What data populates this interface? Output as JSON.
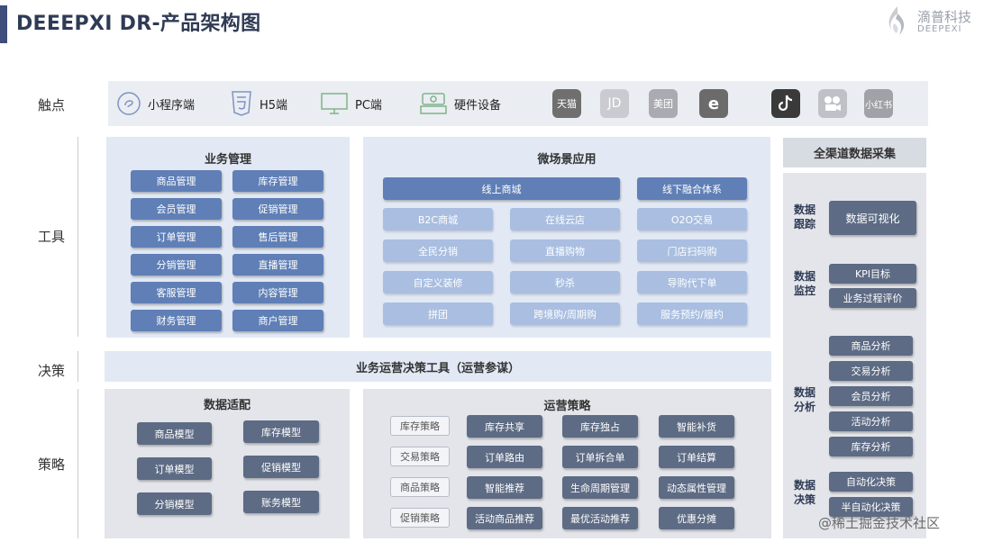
{
  "header": {
    "title": "DEEEPXI DR-产品架构图",
    "logo_cn": "滴普科技",
    "logo_en": "DEEPEXI"
  },
  "rows": {
    "touch": "触点",
    "tools": "工具",
    "decision": "决策",
    "strategy": "策略"
  },
  "touch": {
    "items": [
      "小程序端",
      "H5端",
      "PC端",
      "硬件设备"
    ],
    "apps": [
      "天猫",
      "JD",
      "美团",
      "e",
      "抖音",
      "",
      "小红书"
    ]
  },
  "business": {
    "title": "业务管理",
    "left": [
      "商品管理",
      "会员管理",
      "订单管理",
      "分销管理",
      "客服管理",
      "财务管理"
    ],
    "right": [
      "库存管理",
      "促销管理",
      "售后管理",
      "直播管理",
      "内容管理",
      "商户管理"
    ]
  },
  "micro": {
    "title": "微场景应用",
    "top": [
      "线上商城",
      "线下融合体系"
    ],
    "grid": [
      [
        "B2C商城",
        "在线云店",
        "O2O交易"
      ],
      [
        "全民分销",
        "直播购物",
        "门店扫码购"
      ],
      [
        "自定义装修",
        "秒杀",
        "导购代下单"
      ],
      [
        "拼团",
        "跨境购/周期购",
        "服务预约/履约"
      ]
    ]
  },
  "decision": {
    "label": "业务运营决策工具（运营参谋）"
  },
  "adapt": {
    "title": "数据适配",
    "left": [
      "商品模型",
      "订单模型",
      "分销模型"
    ],
    "right": [
      "库存模型",
      "促销模型",
      "账务模型"
    ]
  },
  "ops": {
    "title": "运营策略",
    "rows": [
      {
        "label": "库存策略",
        "items": [
          "库存共享",
          "库存独占",
          "智能补货"
        ]
      },
      {
        "label": "交易策略",
        "items": [
          "订单路由",
          "订单拆合单",
          "订单结算"
        ]
      },
      {
        "label": "商品策略",
        "items": [
          "智能推荐",
          "生命周期管理",
          "动态属性管理"
        ]
      },
      {
        "label": "促销策略",
        "items": [
          "活动商品推荐",
          "最优活动推荐",
          "优惠分摊"
        ]
      }
    ]
  },
  "collect": {
    "title": "全渠道数据采集",
    "tracking": {
      "label": [
        "数据",
        "跟踪"
      ],
      "items": [
        "数据可视化"
      ]
    },
    "monitor": {
      "label": [
        "数据",
        "监控"
      ],
      "items": [
        "KPI目标",
        "业务过程评价"
      ]
    },
    "analysis": {
      "label": [
        "数据",
        "分析"
      ],
      "items": [
        "商品分析",
        "交易分析",
        "会员分析",
        "活动分析",
        "库存分析"
      ]
    },
    "decide": {
      "label": [
        "数据",
        "决策"
      ],
      "items": [
        "自动化决策",
        "半自动化决策"
      ]
    }
  },
  "watermark": "@稀土掘金技术社区",
  "colors": {
    "dark": "#5f7fb6",
    "light": "#a9bee0",
    "slate": "#5d6b84",
    "panel": "#e2e9f5"
  }
}
